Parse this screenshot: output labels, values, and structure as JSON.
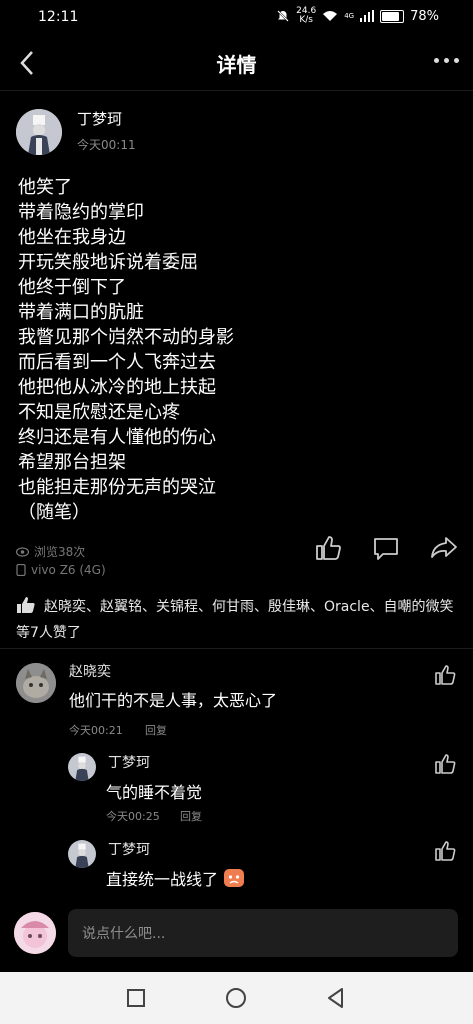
{
  "status": {
    "time": "12:11",
    "speed_top": "24.6",
    "speed_unit": "K/s",
    "signal": "4G",
    "battery": "78%",
    "battery_level": 0.78
  },
  "header": {
    "title": "详情"
  },
  "post": {
    "author": "丁梦珂",
    "time": "今天00:11",
    "lines": [
      "他笑了",
      "带着隐约的掌印",
      "他坐在我身边",
      "开玩笑般地诉说着委屈",
      "他终于倒下了",
      "带着满口的肮脏",
      "我瞥见那个岿然不动的身影",
      "而后看到一个人飞奔过去",
      "他把他从冰冷的地上扶起",
      "不知是欣慰还是心疼",
      "终归还是有人懂他的伤心",
      "希望那台担架",
      "也能担走那份无声的哭泣",
      "（随笔）"
    ],
    "views": "浏览38次",
    "device": "vivo Z6 (4G)"
  },
  "likes": {
    "text": "赵晓奕、赵翼铭、关锦程、何甘雨、殷佳琳、Oracle、自嘲的微笑 等7人赞了"
  },
  "comments": [
    {
      "name": "赵晓奕",
      "text": "他们干的不是人事，太恶心了",
      "time": "今天00:21",
      "reply": "回复"
    },
    {
      "name": "丁梦珂",
      "text": "气的睡不着觉",
      "time": "今天00:25",
      "reply": "回复"
    },
    {
      "name": "丁梦珂",
      "text": "直接统一战线了"
    }
  ],
  "input": {
    "placeholder": "说点什么吧..."
  }
}
